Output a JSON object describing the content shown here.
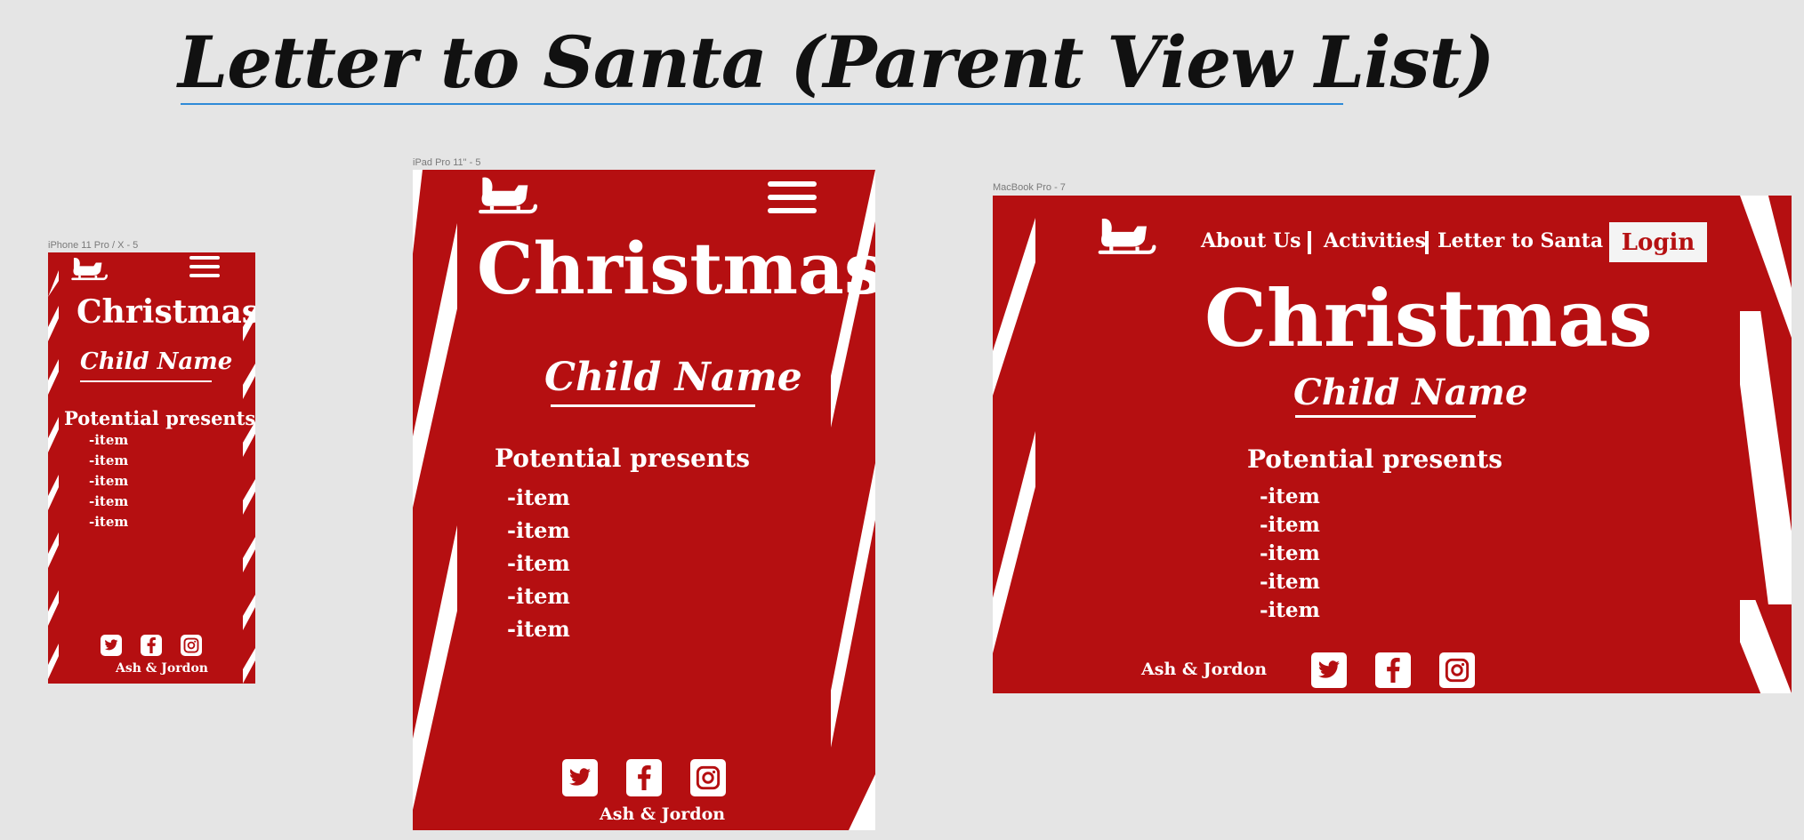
{
  "canvas": {
    "title": "Letter to Santa (Parent View List)"
  },
  "colors": {
    "brand_red": "#b50f11",
    "stripe_white": "#ffffff",
    "canvas_bg": "#e5e5e5",
    "title_underline": "#2f8ad8"
  },
  "frames": {
    "phone": {
      "label": "iPhone 11 Pro / X - 5"
    },
    "tablet": {
      "label": "iPad Pro 11\" - 5"
    },
    "desktop": {
      "label": "MacBook Pro - 7"
    }
  },
  "site": {
    "logo_icon": "sleigh-icon",
    "menu_icon": "hamburger-menu-icon",
    "heading": "Christmas",
    "child_name": "Child Name",
    "list_title": "Potential presents",
    "items": [
      "-item",
      "-item",
      "-item",
      "-item",
      "-item"
    ],
    "footer_credit": "Ash & Jordon",
    "social_icons": [
      "twitter-icon",
      "facebook-icon",
      "instagram-icon"
    ],
    "nav": {
      "about": "About Us",
      "activities": "Activities",
      "letter": "Letter to Santa",
      "login": "Login"
    }
  }
}
